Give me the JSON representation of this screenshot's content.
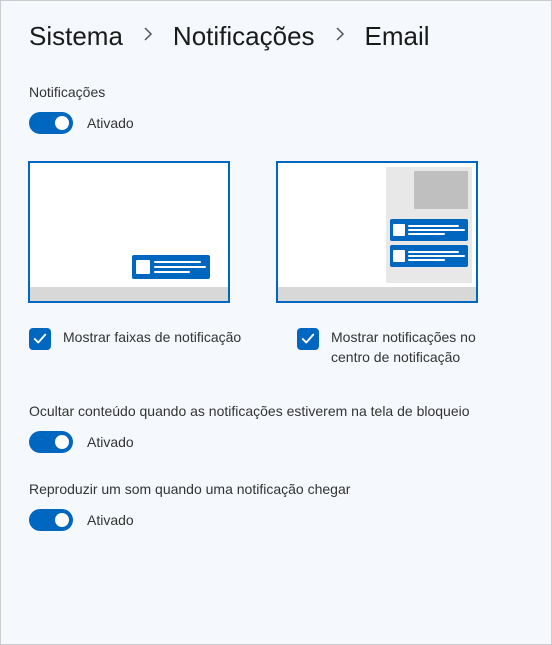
{
  "breadcrumb": {
    "sistema": "Sistema",
    "notificacoes": "Notificações",
    "email": "Email"
  },
  "notifications": {
    "label": "Notificações",
    "state": "Ativado"
  },
  "banners": {
    "label": "Mostrar faixas de notificação"
  },
  "center": {
    "label": "Mostrar notificações no centro de notificação"
  },
  "lockscreen": {
    "label": "Ocultar conteúdo quando as notificações estiverem na tela de bloqueio",
    "state": "Ativado"
  },
  "sound": {
    "label": "Reproduzir um som quando uma notificação chegar",
    "state": "Ativado"
  }
}
